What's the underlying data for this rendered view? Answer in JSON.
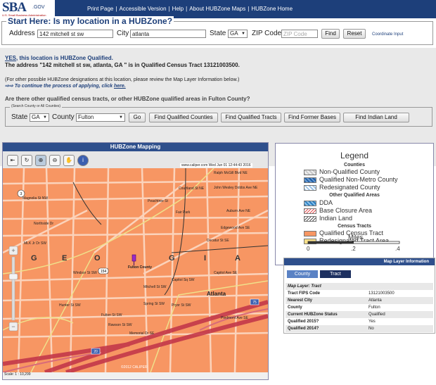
{
  "header": {
    "logo_text": "SBA",
    "logo_gov": ".GOV",
    "logo_subtitle": "U.S. Small Business Administration",
    "nav": [
      "Print Page",
      "Accessible Version",
      "Help",
      "About HUBZone Maps",
      "HUBZone Home"
    ],
    "nav_separator": "|"
  },
  "start": {
    "title": "Start Here: Is my location in a HUBZone?",
    "address_label": "Address",
    "address_value": "142 mitchell st sw",
    "city_label": "City",
    "city_value": "atlanta",
    "state_label": "State",
    "state_value": "GA",
    "zip_label": "ZIP Code",
    "zip_placeholder": "ZIP Code",
    "find_button": "Find",
    "reset_button": "Reset",
    "coordinate_link": "Coordinate Input"
  },
  "result": {
    "yes": "YES",
    "qualified_text": ", this location is HUBZone Qualified.",
    "address_line": "The address \"142 mitchell st sw, atlanta, GA \" is in Qualified Census Tract 13121003500.",
    "other_text": "(For other possible HUBZone designations at this location, please review the Map Layer Information below.)",
    "continue_arrows": "⇨⇨",
    "continue_text": "To continue the process of applying, click",
    "continue_link": "here.",
    "question": "Are there other qualified census tracts, or other HUBZone qualified areas in Fulton County?"
  },
  "search": {
    "legend": "(Search County or All Counties)",
    "state_label": "State",
    "state_value": "GA",
    "county_label": "County",
    "county_value": "Fulton",
    "go_button": "Go",
    "buttons": [
      "Find Qualified Counties",
      "Find Qualified Tracts",
      "Find Former Bases",
      "Find Indian Land"
    ]
  },
  "map": {
    "title": "HUBZone Mapping",
    "stamp": "www.caliper.com Wed Jun 01 12:44:43 2016",
    "scale": "Scale: 1 : 10,299",
    "copyright": "©2012 CALIPER",
    "georgia": [
      "G",
      "E",
      "O",
      "G",
      "I",
      "A"
    ],
    "city_label": "Atlanta",
    "marker_label": "Fulton County",
    "route_badges": [
      "3",
      "154",
      "75",
      "20"
    ],
    "streets": [
      "Ralph McGill Blvd NE",
      "John Wesley Dobbs Ave NE",
      "Edgewood Ave SE",
      "Auburn Ave NE",
      "Decatur St SE",
      "Peachtree St",
      "Mitchell St SW",
      "Capitol Ave SE",
      "Memorial Dr SE",
      "Piedmont Ave SE",
      "Courtland St NE",
      "Windsor St SW",
      "Fulton St SW",
      "Magnolia St NW",
      "Spring St SW",
      "Northside Dr",
      "Rawson St SW",
      "Pryor St SW",
      "Hunter St SW",
      "Capitol Sq SW",
      "Fair Park",
      "MLK Jr Dr SW"
    ]
  },
  "legend": {
    "title": "Legend",
    "counties_head": "Counties",
    "other_head": "Other Qualified Areas",
    "tracts_head": "Census Tracts",
    "items": [
      {
        "label": "Non-Qualified County",
        "color": "#c8c8c8"
      },
      {
        "label": "Qualified Non-Metro County",
        "color": "#1f5fa8"
      },
      {
        "label": "Redesignated County",
        "color": "#9fc5e8"
      },
      {
        "label": "DDA",
        "color": "#2a7fc0"
      },
      {
        "label": "Base Closure Area",
        "color": "#e05050"
      },
      {
        "label": "Indian Land",
        "color": "#555555"
      },
      {
        "label": "Qualified Census Tract",
        "color": "#f79663"
      },
      {
        "label": "Redesignated Tract Area",
        "color": "#f8e08a"
      }
    ],
    "miles_label": "Miles",
    "miles_ticks": [
      "0",
      ".2",
      ".4"
    ]
  },
  "layer_info": {
    "title": "Map Layer Information",
    "tabs": [
      "County",
      "Tract"
    ],
    "rows": [
      {
        "k": "Map Layer: Tract",
        "v": ""
      },
      {
        "k": "Tract FIPS Code",
        "v": "13121003500"
      },
      {
        "k": "Nearest City",
        "v": "Atlanta"
      },
      {
        "k": "County",
        "v": "Fulton"
      },
      {
        "k": "Current HUBZone Status",
        "v": "Qualified"
      },
      {
        "k": "Qualified 2015?",
        "v": "Yes"
      },
      {
        "k": "Qualified 2014?",
        "v": "No"
      }
    ]
  }
}
